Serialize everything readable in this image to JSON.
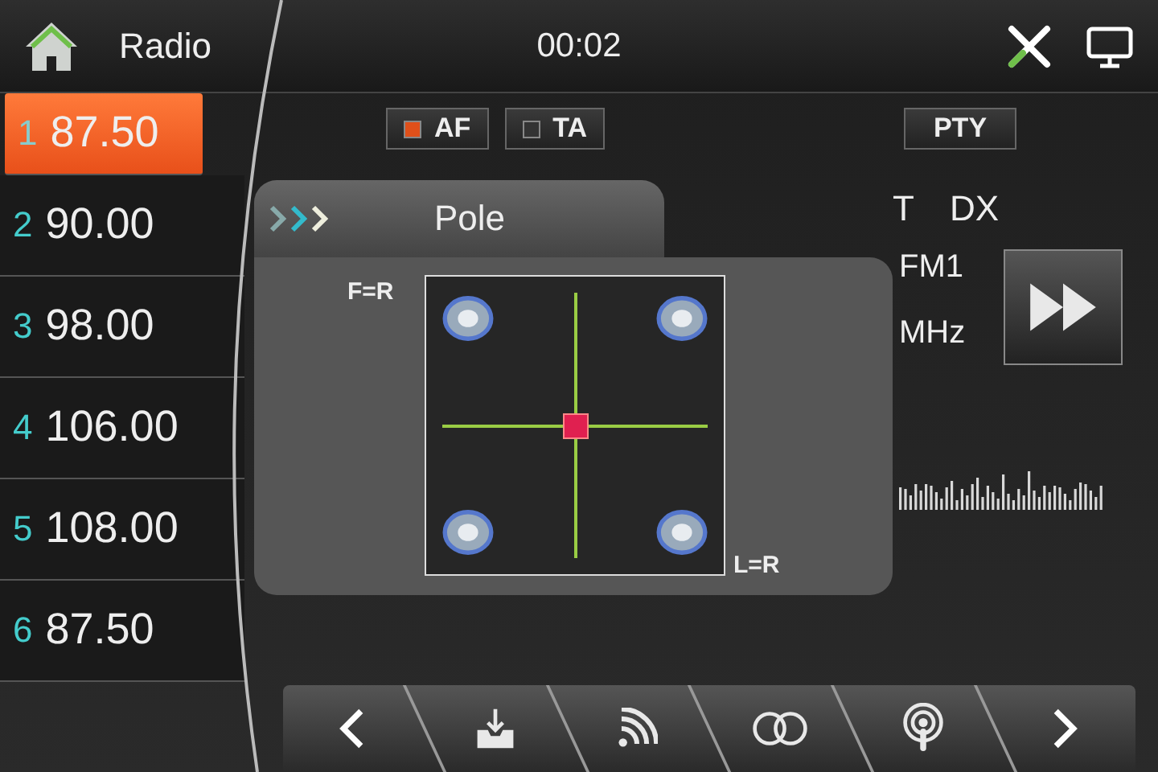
{
  "header": {
    "title": "Radio",
    "clock": "00:02"
  },
  "presets": [
    {
      "number": "1",
      "frequency": "87.50",
      "selected": true
    },
    {
      "number": "2",
      "frequency": "90.00",
      "selected": false
    },
    {
      "number": "3",
      "frequency": "98.00",
      "selected": false
    },
    {
      "number": "4",
      "frequency": "106.00",
      "selected": false
    },
    {
      "number": "5",
      "frequency": "108.00",
      "selected": false
    },
    {
      "number": "6",
      "frequency": "87.50",
      "selected": false
    }
  ],
  "toggles": [
    {
      "label": "AF",
      "checked": true
    },
    {
      "label": "TA",
      "checked": false
    }
  ],
  "pty_button": "PTY",
  "indicators": [
    "T",
    "DX"
  ],
  "band": "FM1",
  "unit": "MHz",
  "pole_panel": {
    "title": "Pole",
    "front_rear_label": "F=R",
    "left_right_label": "L=R"
  },
  "bottom_bar": [
    {
      "kind": "prev"
    },
    {
      "kind": "save"
    },
    {
      "kind": "signal"
    },
    {
      "kind": "stereo"
    },
    {
      "kind": "podcast"
    },
    {
      "kind": "next"
    }
  ]
}
